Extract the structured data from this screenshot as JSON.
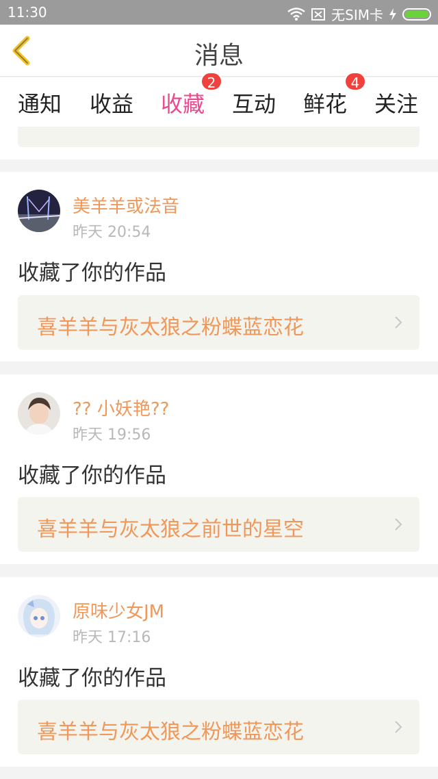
{
  "status": {
    "time": "11:30",
    "carrier": "无SIM卡",
    "colors": {
      "bar": "#9b9b9b",
      "battery": "#6ad33a"
    }
  },
  "header": {
    "title": "消息"
  },
  "tabs": [
    {
      "label": "通知"
    },
    {
      "label": "收益"
    },
    {
      "label": "收藏",
      "badge": "2",
      "active": true
    },
    {
      "label": "互动"
    },
    {
      "label": "鲜花",
      "badge": "4"
    },
    {
      "label": "关注"
    }
  ],
  "messages": [
    {
      "user": "美羊羊或法音",
      "time": "昨天 20:54",
      "action": "收藏了你的作品",
      "work": "喜羊羊与灰太狼之粉蝶蓝恋花"
    },
    {
      "user": "?? 小妖艳??",
      "time": "昨天 19:56",
      "action": "收藏了你的作品",
      "work": "喜羊羊与灰太狼之前世的星空"
    },
    {
      "user": "原味少女JM",
      "time": "昨天 17:16",
      "action": "收藏了你的作品",
      "work": "喜羊羊与灰太狼之粉蝶蓝恋花"
    }
  ],
  "theme": {
    "accent_pink": "#e94a8f",
    "name_orange": "#f0975a",
    "badge_red": "#f0413c",
    "back_yellow": "#f2c32c"
  }
}
